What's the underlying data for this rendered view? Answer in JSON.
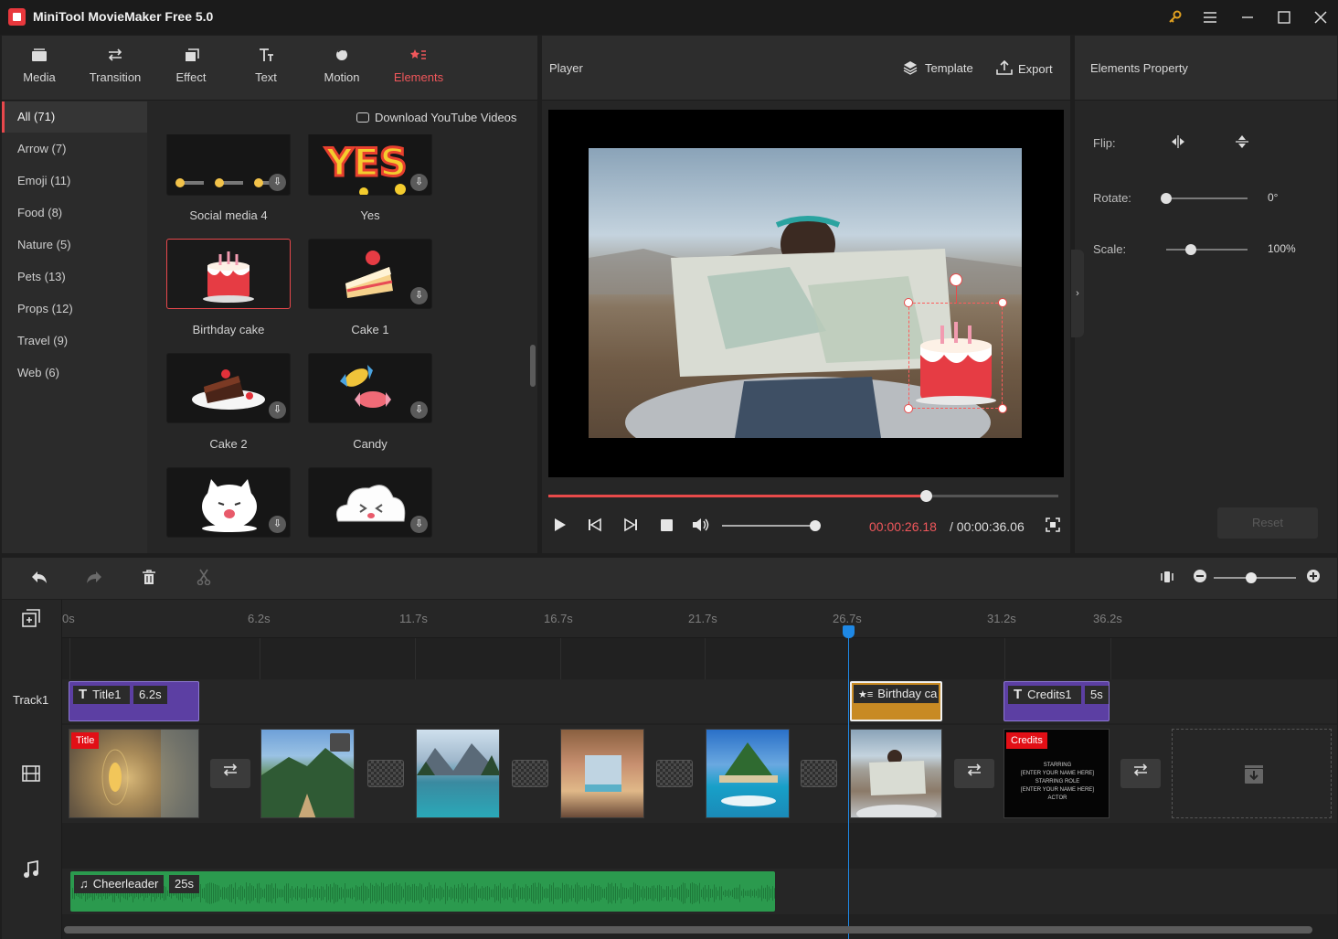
{
  "app": {
    "title": "MiniTool MovieMaker Free 5.0"
  },
  "window_controls": {
    "key_icon": "key-icon",
    "menu_icon": "menu-icon",
    "minimize": "—",
    "maximize": "☐",
    "close": "✕"
  },
  "library": {
    "tabs": [
      {
        "label": "Media",
        "icon": "media-icon"
      },
      {
        "label": "Transition",
        "icon": "transition-icon"
      },
      {
        "label": "Effect",
        "icon": "effect-icon"
      },
      {
        "label": "Text",
        "icon": "text-icon"
      },
      {
        "label": "Motion",
        "icon": "motion-icon"
      },
      {
        "label": "Elements",
        "icon": "elements-icon",
        "active": true
      }
    ],
    "categories": [
      "All (71)",
      "Arrow (7)",
      "Emoji (11)",
      "Food (8)",
      "Nature (5)",
      "Pets (13)",
      "Props (12)",
      "Travel (9)",
      "Web (6)"
    ],
    "active_category": "All (71)",
    "youtube_link": "Download YouTube Videos",
    "tiles": [
      {
        "name": "Social media 4"
      },
      {
        "name": "Yes",
        "art_text": "YES"
      },
      {
        "name": "Birthday cake",
        "selected": true
      },
      {
        "name": "Cake 1"
      },
      {
        "name": "Cake 2"
      },
      {
        "name": "Candy"
      },
      {
        "name": ""
      },
      {
        "name": ""
      }
    ]
  },
  "player": {
    "title": "Player",
    "template_label": "Template",
    "export_label": "Export",
    "time_current": "00:00:26.18",
    "time_total": "/ 00:00:36.06",
    "progress_fraction": 0.74,
    "volume_fraction": 1.0
  },
  "properties": {
    "title": "Elements Property",
    "flip_label": "Flip:",
    "rotate_label": "Rotate:",
    "rotate_value": "0°",
    "rotate_fraction": 0.0,
    "scale_label": "Scale:",
    "scale_value": "100%",
    "scale_fraction": 0.3,
    "reset_label": "Reset"
  },
  "timeline": {
    "ruler_ticks": [
      "0s",
      "6.2s",
      "11.7s",
      "16.7s",
      "21.7s",
      "26.7s",
      "31.2s",
      "36.2s"
    ],
    "track1_label": "Track1",
    "zoom_fraction": 0.45,
    "clips": {
      "title1_name": "Title1",
      "title1_dur": "6.2s",
      "birthday_name": "Birthday ca",
      "credits_name": "Credits1",
      "credits_dur": "5s"
    },
    "video_tags": {
      "title": "Title",
      "credits": "Credits"
    },
    "credits_text": [
      "STARRING",
      "[ENTER YOUR NAME HERE]",
      "STARRING ROLE",
      "[ENTER YOUR NAME HERE]",
      "ACTOR"
    ],
    "audio": {
      "name": "Cheerleader",
      "dur": "25s"
    }
  },
  "colors": {
    "accent": "#e8484c",
    "playhead": "#1e88e5",
    "title_clip": "#5c3fa3",
    "element_clip": "#c88a23",
    "audio_clip": "#2b9a4e"
  }
}
